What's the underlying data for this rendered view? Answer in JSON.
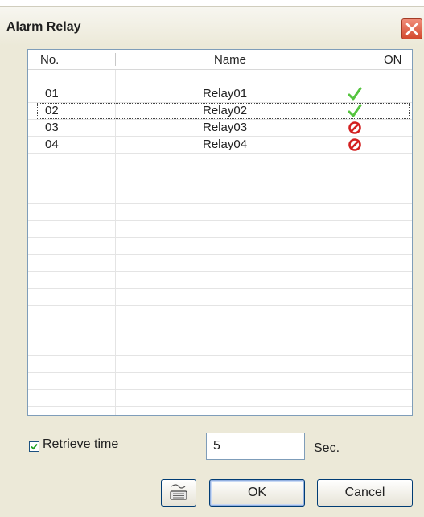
{
  "window": {
    "title": "Alarm Relay",
    "icons": {
      "close": "close-icon"
    }
  },
  "grid": {
    "columns": [
      "No.",
      "Name",
      "ON"
    ],
    "rows": [
      {
        "no": "01",
        "name": "Relay01",
        "on": true,
        "status_icon": "checkmark-icon"
      },
      {
        "no": "02",
        "name": "Relay02",
        "on": true,
        "status_icon": "checkmark-icon"
      },
      {
        "no": "03",
        "name": "Relay03",
        "on": false,
        "status_icon": "prohibited-icon"
      },
      {
        "no": "04",
        "name": "Relay04",
        "on": false,
        "status_icon": "prohibited-icon"
      }
    ],
    "status_colors": {
      "on": "#55c43f",
      "off": "#d32020"
    }
  },
  "retrieve": {
    "checkbox_label": "Retrieve time",
    "checked": true,
    "value": "5",
    "unit": "Sec."
  },
  "buttons": {
    "keyboard_icon": "keyboard-icon",
    "ok": "OK",
    "cancel": "Cancel"
  }
}
